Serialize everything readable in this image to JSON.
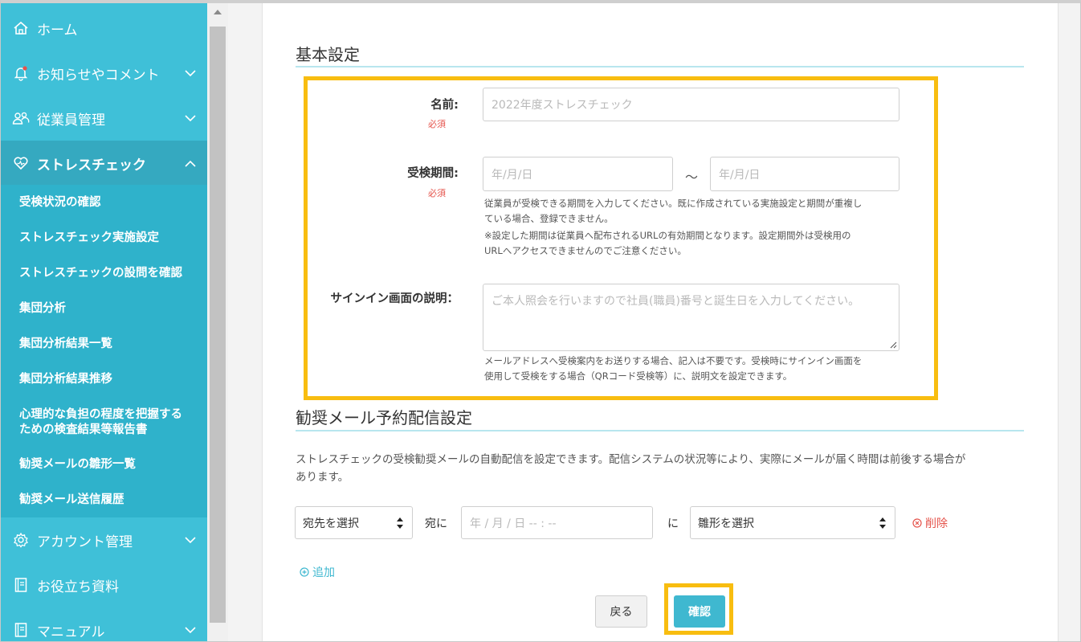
{
  "sidebar": {
    "nav": [
      {
        "label": "ホーム",
        "icon": "home-icon"
      },
      {
        "label": "お知らせやコメント",
        "icon": "bell-icon",
        "chevron": "chevron-down-icon"
      },
      {
        "label": "従業員管理",
        "icon": "users-icon",
        "chevron": "chevron-down-icon"
      },
      {
        "label": "ストレスチェック",
        "icon": "heart-icon",
        "chevron": "chevron-up-icon"
      },
      {
        "label": "アカウント管理",
        "icon": "gear-icon",
        "chevron": "chevron-down-icon"
      },
      {
        "label": "お役立ち資料",
        "icon": "book-icon"
      },
      {
        "label": "マニュアル",
        "icon": "book-icon",
        "chevron": "chevron-down-icon"
      }
    ],
    "sub_items": [
      "受検状況の確認",
      "ストレスチェック実施設定",
      "ストレスチェックの設問を確認",
      "集団分析",
      "集団分析結果一覧",
      "集団分析結果推移",
      "心理的な負担の程度を把握する",
      "ための検査結果等報告書",
      "勧奨メールの雛形一覧",
      "勧奨メール送信履歴"
    ]
  },
  "basic": {
    "title": "基本設定",
    "name_label": "名前:",
    "required": "必須",
    "name_placeholder": "2022年度ストレスチェック",
    "period_label": "受検期間:",
    "date_placeholder": "年/月/日",
    "tilde": "～",
    "period_help_1": "従業員が受検できる期間を入力してください。既に作成されている実施設定と期間が重複し",
    "period_help_2": "ている場合、登録できません。",
    "period_help_3": "※設定した期間は従業員へ配布されるURLの有効期間となります。設定期間外は受検用の",
    "period_help_4": "URLへアクセスできませんのでご注意ください。",
    "signin_label": "サインイン画面の説明：",
    "signin_placeholder": "ご本人照会を行いますので社員(職員)番号と誕生日を入力してください。",
    "signin_help_1": "メールアドレスへ受検案内をお送りする場合、記入は不要です。受検時にサインイン画面を",
    "signin_help_2": "使用して受検をする場合（QRコード受検等）に、説明文を設定できます。"
  },
  "mail": {
    "title": "勧奨メール予約配信設定",
    "desc_1": "ストレスチェックの受検勧奨メールの自動配信を設定できます。配信システムの状況等により、実際にメールが届く時間は前後する場合が",
    "desc_2": "あります。",
    "recipient_select": "宛先を選択",
    "to_label": "宛に",
    "datetime_placeholder": "年 / 月 / 日 -- : --",
    "ni_label": "に",
    "template_select": "雛形を選択",
    "delete": "削除",
    "add": "追加"
  },
  "buttons": {
    "back": "戻る",
    "confirm": "確認"
  },
  "colors": {
    "sidebar": "#3fc0d8",
    "highlight": "#f8bd10",
    "accent": "#3fb8d0",
    "danger": "#e5534b"
  }
}
